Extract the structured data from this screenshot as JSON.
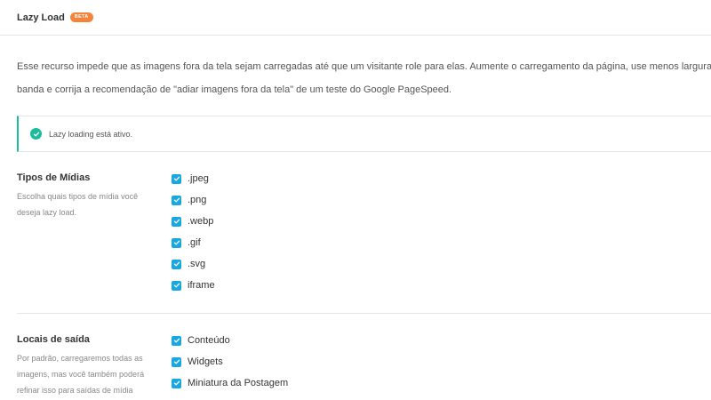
{
  "header": {
    "title": "Lazy Load",
    "badge": "BETA"
  },
  "description": {
    "line1": "Esse recurso impede que as imagens fora da tela sejam carregadas até que um visitante role para elas. Aumente o carregamento da página, use menos largura de",
    "line2": "banda e corrija a recomendação de \"adiar imagens fora da tela\" de um teste do Google PageSpeed."
  },
  "notice": {
    "text": "Lazy loading está ativo.",
    "color": "#1abc9c"
  },
  "media_types": {
    "title": "Tipos de Mídias",
    "description": "Escolha quais tipos de mídia você deseja lazy load.",
    "options": [
      {
        "label": ".jpeg",
        "checked": true
      },
      {
        "label": ".png",
        "checked": true
      },
      {
        "label": ".webp",
        "checked": true
      },
      {
        "label": ".gif",
        "checked": true
      },
      {
        "label": ".svg",
        "checked": true
      },
      {
        "label": "iframe",
        "checked": true
      }
    ]
  },
  "output_locations": {
    "title": "Locais de saída",
    "description": "Por padrão, carregaremos todas as imagens, mas você também poderá refinar isso para saídas de mídia",
    "options": [
      {
        "label": "Conteúdo",
        "checked": true
      },
      {
        "label": "Widgets",
        "checked": true
      },
      {
        "label": "Miniatura da Postagem",
        "checked": true
      }
    ]
  },
  "colors": {
    "checkbox": "#17a8e3",
    "badge": "#f5833a"
  }
}
